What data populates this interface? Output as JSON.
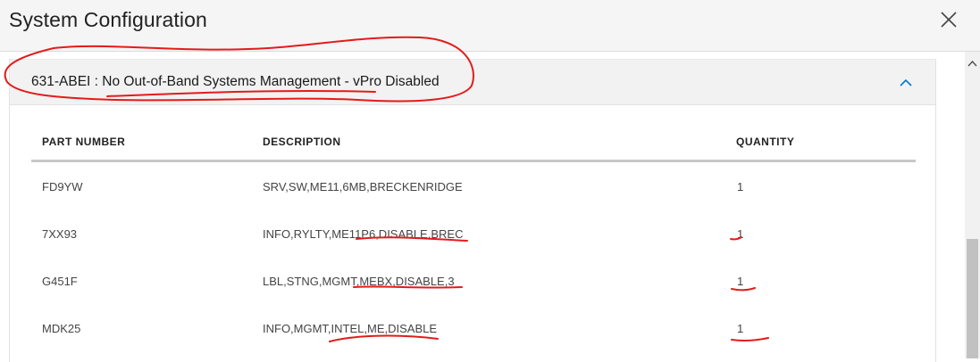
{
  "dialog": {
    "title": "System Configuration",
    "close_icon": "close-icon"
  },
  "accordion": {
    "title": "631-ABEI : No Out-of-Band Systems Management - vPro Disabled",
    "expanded": true,
    "toggle_icon": "chevron-up-icon"
  },
  "table": {
    "columns": [
      "PART NUMBER",
      "DESCRIPTION",
      "QUANTITY"
    ],
    "rows": [
      {
        "part": "FD9YW",
        "description": "SRV,SW,ME11,6MB,BRECKENRIDGE",
        "quantity": "1"
      },
      {
        "part": "7XX93",
        "description": "INFO,RYLTY,ME11P6,DISABLE,BREC",
        "quantity": "1"
      },
      {
        "part": "G451F",
        "description": "LBL,STNG,MGMT,MEBX,DISABLE,3",
        "quantity": "1"
      },
      {
        "part": "MDK25",
        "description": "INFO,MGMT,INTEL,ME,DISABLE",
        "quantity": "1"
      }
    ]
  },
  "colors": {
    "header_bg": "#f5f5f5",
    "accordion_bg": "#f2f2f2",
    "chevron": "#0076ce",
    "annotation": "#e31b1b"
  }
}
